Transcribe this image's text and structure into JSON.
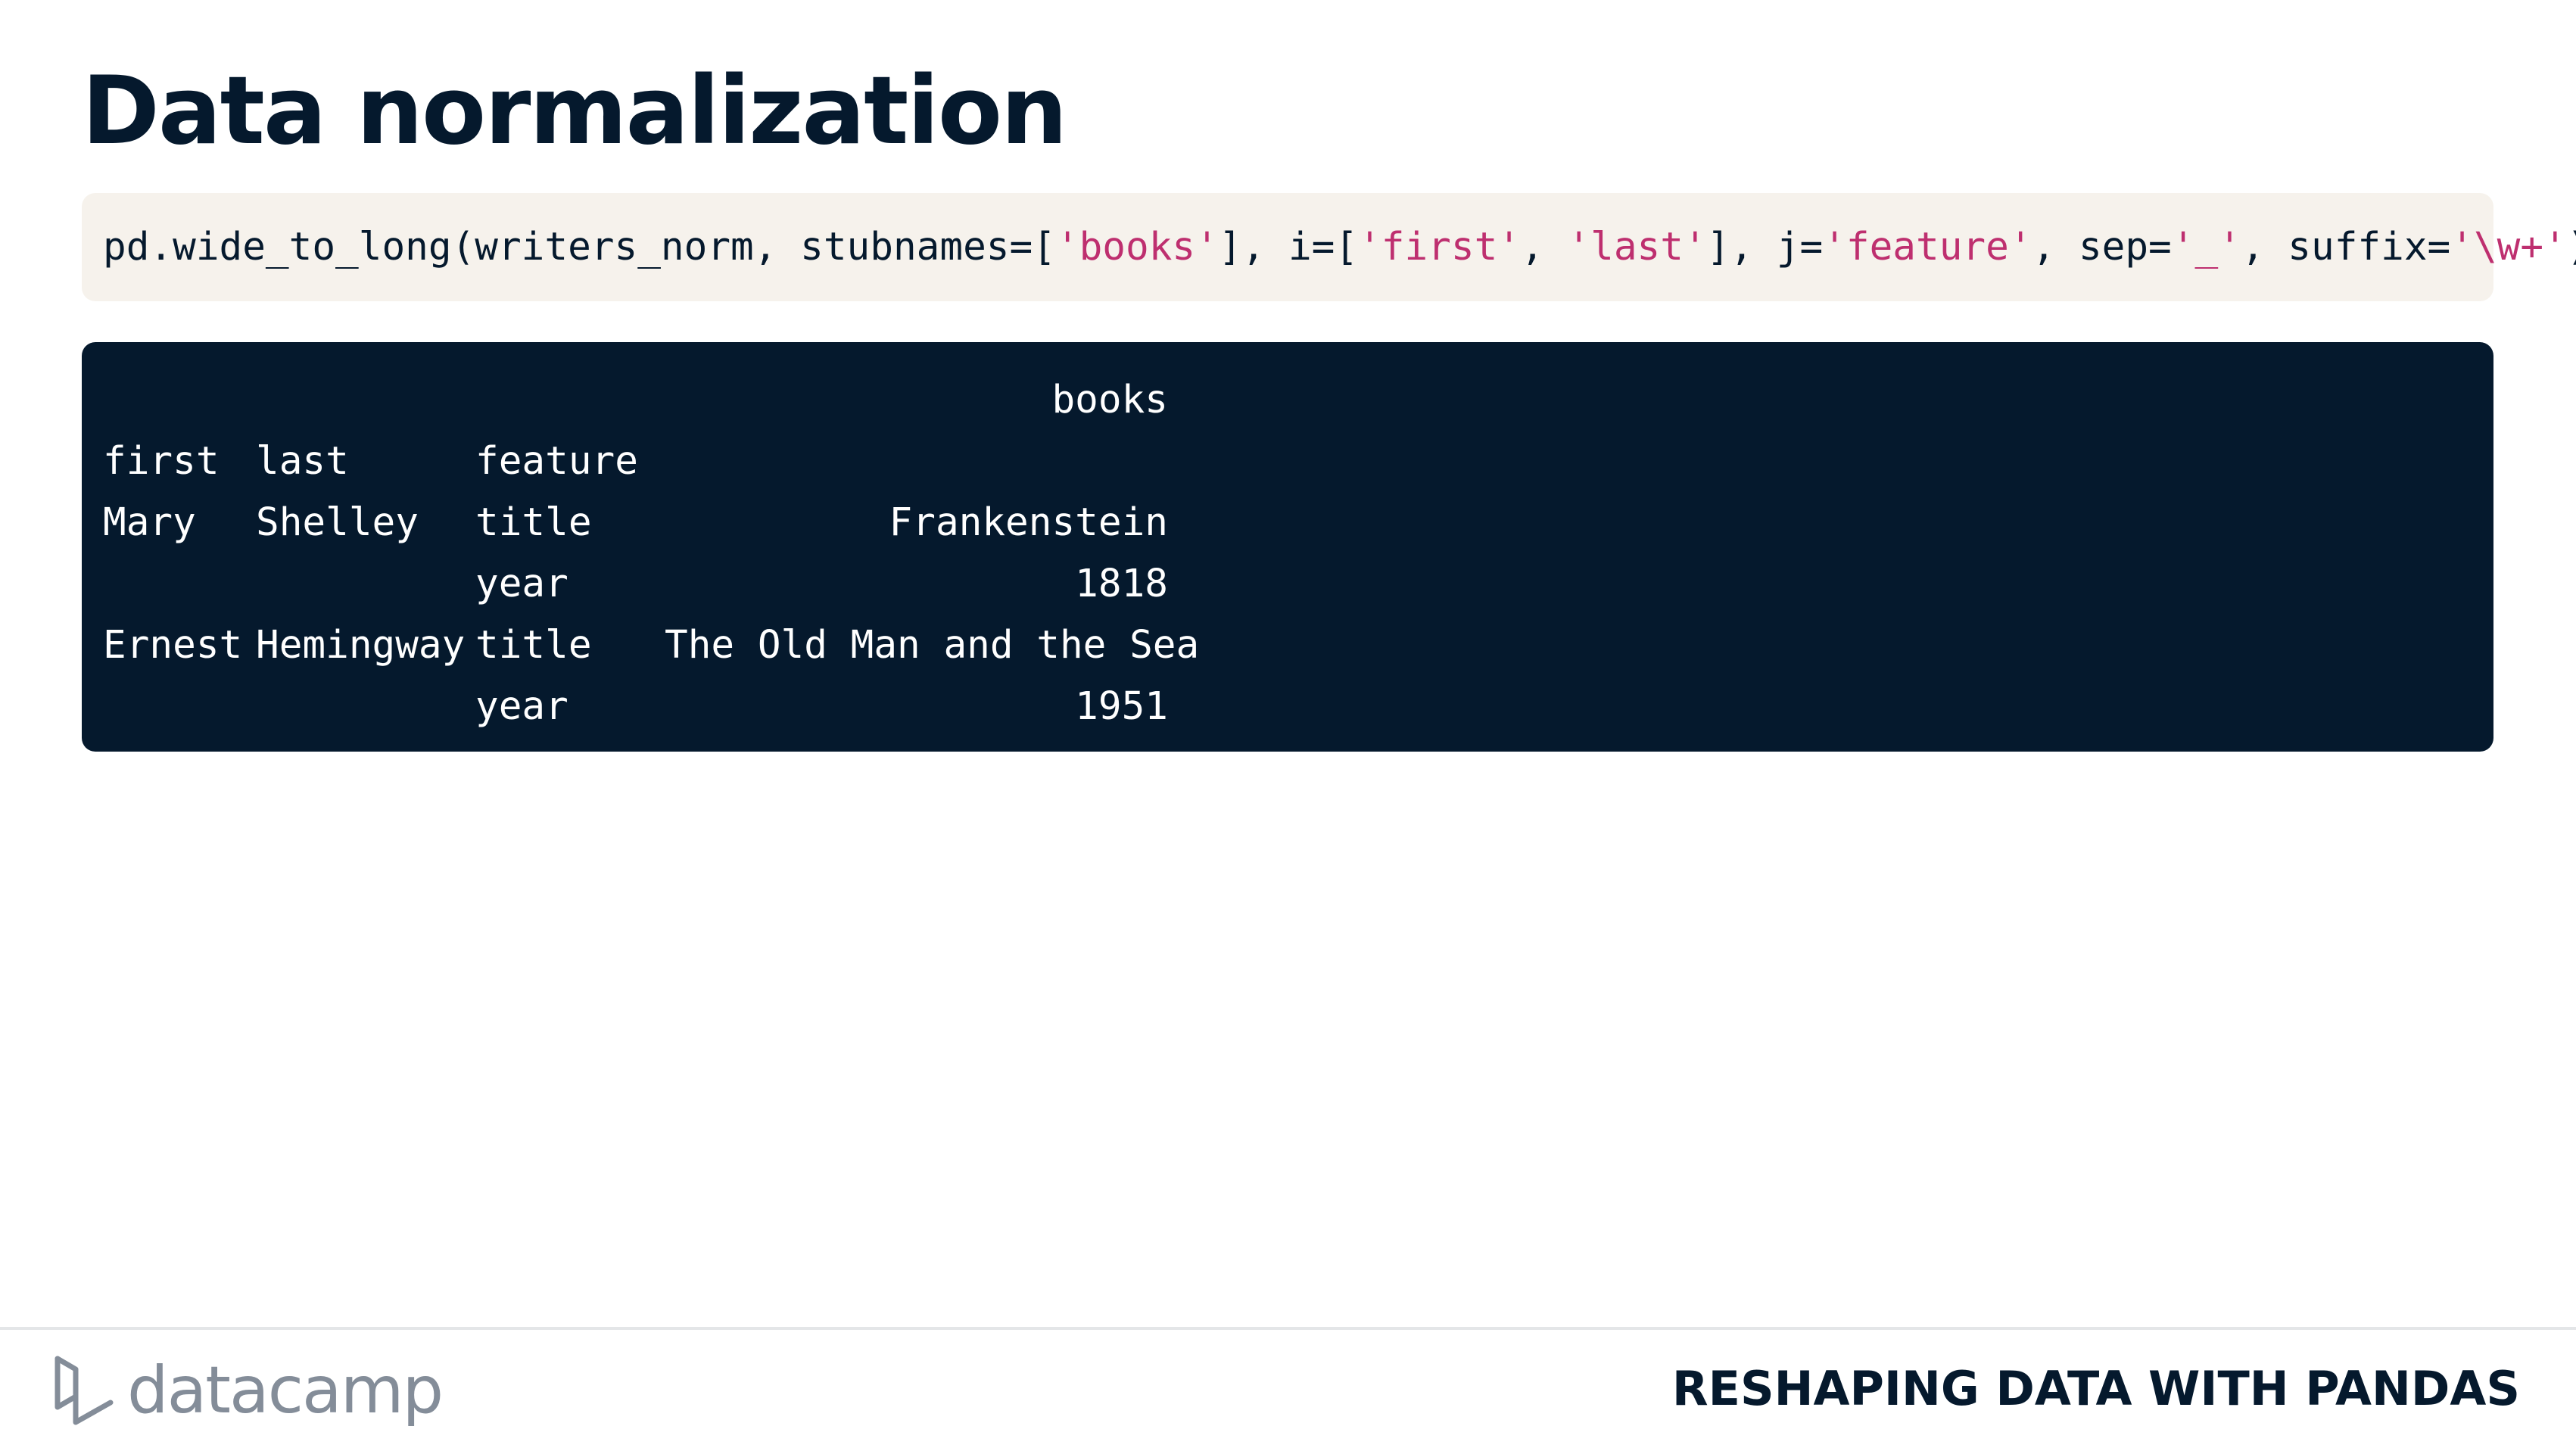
{
  "slide": {
    "title": "Data normalization"
  },
  "code": {
    "segments": [
      {
        "text": "pd.wide_to_long(writers_norm, stubnames=[",
        "kind": "plain"
      },
      {
        "text": "'books'",
        "kind": "string"
      },
      {
        "text": "], i=[",
        "kind": "plain"
      },
      {
        "text": "'first'",
        "kind": "string"
      },
      {
        "text": ", ",
        "kind": "plain"
      },
      {
        "text": "'last'",
        "kind": "string"
      },
      {
        "text": "], j=",
        "kind": "plain"
      },
      {
        "text": "'feature'",
        "kind": "string"
      },
      {
        "text": ", sep=",
        "kind": "plain"
      },
      {
        "text": "'_'",
        "kind": "string"
      },
      {
        "text": ", suffix=",
        "kind": "plain"
      },
      {
        "text": "'\\w+'",
        "kind": "string"
      },
      {
        "text": ")",
        "kind": "plain"
      }
    ],
    "string_color": "#BE2F6F"
  },
  "output": {
    "column_header": "books",
    "index_names": [
      "first",
      "last",
      "feature"
    ],
    "rows": [
      [
        "Mary",
        "Shelley",
        "title",
        "Frankenstein"
      ],
      [
        "",
        "",
        "year",
        "1818"
      ],
      [
        "Ernest",
        "Hemingway",
        "title",
        "The Old Man and the Sea"
      ],
      [
        "",
        "",
        "year",
        "1951"
      ]
    ]
  },
  "footer": {
    "logo_text": "datacamp",
    "logo_icon": "datacamp-logo-icon",
    "course_title": "RESHAPING DATA WITH PANDAS"
  },
  "colors": {
    "navy": "#05192D",
    "code_bg": "#F6F2EC",
    "gray": "#848D99"
  }
}
